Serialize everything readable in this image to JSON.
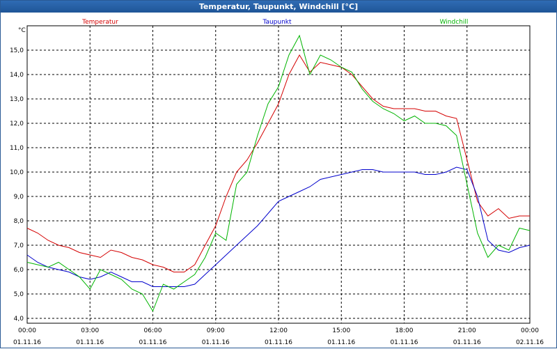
{
  "window": {
    "title": "Temperatur, Taupunkt, Windchill [°C]"
  },
  "chart_data": {
    "type": "line",
    "title": "Temperatur, Taupunkt, Windchill [°C]",
    "ylabel": "°C",
    "xlabel": "",
    "ylim": [
      3.8,
      16.0
    ],
    "xlim": [
      0,
      24
    ],
    "grid": true,
    "legend_position": "top",
    "y_ticks": [
      "4,0",
      "5,0",
      "6,0",
      "7,0",
      "8,0",
      "9,0",
      "10,0",
      "11,0",
      "12,0",
      "13,0",
      "14,0",
      "15,0"
    ],
    "x_ticks": [
      {
        "time": "00:00",
        "date": "01.11.16"
      },
      {
        "time": "03:00",
        "date": "01.11.16"
      },
      {
        "time": "06:00",
        "date": "01.11.16"
      },
      {
        "time": "09:00",
        "date": "01.11.16"
      },
      {
        "time": "12:00",
        "date": "01.11.16"
      },
      {
        "time": "15:00",
        "date": "01.11.16"
      },
      {
        "time": "18:00",
        "date": "01.11.16"
      },
      {
        "time": "21:00",
        "date": "01.11.16"
      },
      {
        "time": "00:00",
        "date": "02.11.16"
      }
    ],
    "series": [
      {
        "name": "Temperatur",
        "color": "#d40000",
        "x": [
          0,
          0.5,
          1,
          1.5,
          2,
          2.5,
          3,
          3.5,
          4,
          4.5,
          5,
          5.5,
          6,
          6.5,
          7,
          7.5,
          8,
          8.5,
          9,
          9.5,
          10,
          10.5,
          11,
          11.5,
          12,
          12.5,
          13,
          13.5,
          14,
          14.5,
          15,
          15.5,
          16,
          16.5,
          17,
          17.5,
          18,
          18.5,
          19,
          19.5,
          20,
          20.5,
          21,
          21.5,
          22,
          22.5,
          23,
          23.5,
          24
        ],
        "values": [
          7.7,
          7.5,
          7.2,
          7.0,
          6.9,
          6.7,
          6.6,
          6.5,
          6.8,
          6.7,
          6.5,
          6.4,
          6.2,
          6.1,
          5.9,
          5.9,
          6.2,
          7.0,
          7.8,
          9.0,
          10.0,
          10.5,
          11.2,
          12.0,
          12.8,
          14.0,
          14.8,
          14.1,
          14.5,
          14.4,
          14.3,
          14.0,
          13.5,
          13.0,
          12.7,
          12.6,
          12.6,
          12.6,
          12.5,
          12.5,
          12.3,
          12.2,
          10.5,
          8.8,
          8.2,
          8.5,
          8.1,
          8.2,
          8.2
        ]
      },
      {
        "name": "Taupunkt",
        "color": "#0000cc",
        "x": [
          0,
          0.5,
          1,
          1.5,
          2,
          2.5,
          3,
          3.5,
          4,
          4.5,
          5,
          5.5,
          6,
          6.5,
          7,
          7.5,
          8,
          8.5,
          9,
          9.5,
          10,
          10.5,
          11,
          11.5,
          12,
          12.5,
          13,
          13.5,
          14,
          14.5,
          15,
          15.5,
          16,
          16.5,
          17,
          17.5,
          18,
          18.5,
          19,
          19.5,
          20,
          20.5,
          21,
          21.5,
          22,
          22.5,
          23,
          23.5,
          24
        ],
        "values": [
          6.6,
          6.3,
          6.1,
          6.0,
          5.9,
          5.7,
          5.6,
          5.7,
          5.9,
          5.7,
          5.5,
          5.5,
          5.3,
          5.3,
          5.3,
          5.3,
          5.4,
          5.8,
          6.2,
          6.6,
          7.0,
          7.4,
          7.8,
          8.3,
          8.8,
          9.0,
          9.2,
          9.4,
          9.7,
          9.8,
          9.9,
          10.0,
          10.1,
          10.1,
          10.0,
          10.0,
          10.0,
          10.0,
          9.9,
          9.9,
          10.0,
          10.2,
          10.1,
          9.0,
          7.2,
          6.8,
          6.7,
          6.9,
          7.0
        ]
      },
      {
        "name": "Windchill",
        "color": "#00b400",
        "x": [
          0,
          0.5,
          1,
          1.5,
          2,
          2.5,
          3,
          3.5,
          4,
          4.5,
          5,
          5.5,
          6,
          6.5,
          7,
          7.5,
          8,
          8.5,
          9,
          9.5,
          10,
          10.5,
          11,
          11.5,
          12,
          12.5,
          13,
          13.5,
          14,
          14.5,
          15,
          15.5,
          16,
          16.5,
          17,
          17.5,
          18,
          18.5,
          19,
          19.5,
          20,
          20.5,
          21,
          21.5,
          22,
          22.5,
          23,
          23.5,
          24
        ],
        "values": [
          6.3,
          6.2,
          6.1,
          6.3,
          6.0,
          5.7,
          5.2,
          6.0,
          5.8,
          5.6,
          5.2,
          5.0,
          4.3,
          5.4,
          5.2,
          5.5,
          5.8,
          6.5,
          7.5,
          7.2,
          9.5,
          10.0,
          11.5,
          12.8,
          13.5,
          14.8,
          15.6,
          14.0,
          14.8,
          14.6,
          14.3,
          14.1,
          13.4,
          12.9,
          12.6,
          12.4,
          12.1,
          12.3,
          12.0,
          12.0,
          11.9,
          11.5,
          9.5,
          7.5,
          6.5,
          7.0,
          6.8,
          7.7,
          7.6
        ]
      }
    ]
  }
}
